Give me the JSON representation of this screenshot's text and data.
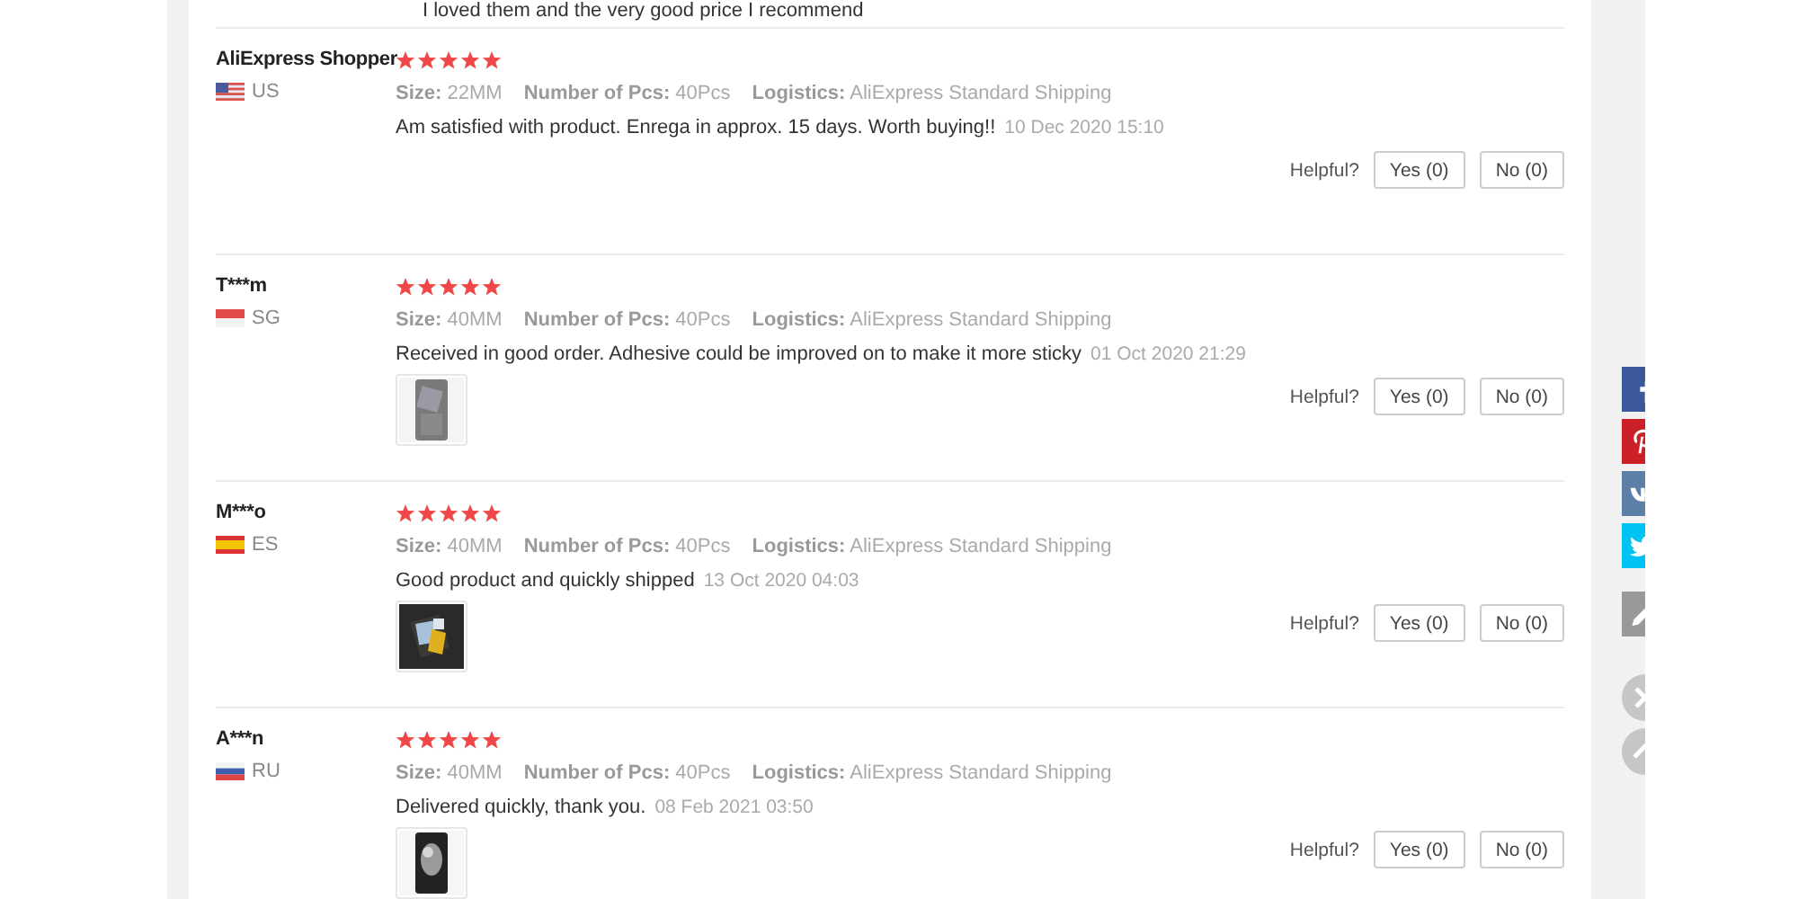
{
  "previous_review_tail": "I loved them and the very good price I recommend",
  "reviews": [
    {
      "name": "AliExpress Shopper",
      "country": "US",
      "stars": 5,
      "attributes": [
        {
          "label": "Size:",
          "value": "22MM"
        },
        {
          "label": "Number of Pcs:",
          "value": "40Pcs"
        },
        {
          "label": "Logistics:",
          "value": "AliExpress Standard Shipping"
        }
      ],
      "text": "Am satisfied with product. Enrega in approx. 15 days. Worth buying!!",
      "date": "10 Dec 2020 15:10",
      "helpful": "Helpful?",
      "yes": "Yes (0)",
      "no": "No (0)"
    },
    {
      "name": "T***m",
      "country": "SG",
      "stars": 5,
      "attributes": [
        {
          "label": "Size:",
          "value": "40MM"
        },
        {
          "label": "Number of Pcs:",
          "value": "40Pcs"
        },
        {
          "label": "Logistics:",
          "value": "AliExpress Standard Shipping"
        }
      ],
      "text": "Received in good order. Adhesive could be improved on to make it more sticky",
      "date": "01 Oct 2020 21:29",
      "photos": [
        {
          "kind": "picture"
        }
      ],
      "helpful": "Helpful?",
      "yes": "Yes (0)",
      "no": "No (0)"
    },
    {
      "name": "M***o",
      "country": "ES",
      "stars": 5,
      "attributes": [
        {
          "label": "Size:",
          "value": "40MM"
        },
        {
          "label": "Number of Pcs:",
          "value": "40Pcs"
        },
        {
          "label": "Logistics:",
          "value": "AliExpress Standard Shipping"
        }
      ],
      "text": "Good product and quickly shipped",
      "date": "13 Oct 2020 04:03",
      "photos": [
        {
          "kind": "picture"
        }
      ],
      "helpful": "Helpful?",
      "yes": "Yes (0)",
      "no": "No (0)"
    },
    {
      "name": "A***n",
      "country": "RU",
      "stars": 5,
      "attributes": [
        {
          "label": "Size:",
          "value": "40MM"
        },
        {
          "label": "Number of Pcs:",
          "value": "40Pcs"
        },
        {
          "label": "Logistics:",
          "value": "AliExpress Standard Shipping"
        }
      ],
      "text": "Delivered quickly, thank you.",
      "date": "08 Feb 2021 03:50",
      "photos": [
        {
          "kind": "picture"
        }
      ],
      "helpful": "Helpful?",
      "yes": "Yes (0)",
      "no": "No (0)"
    }
  ],
  "share_buttons": [
    {
      "kind": "facebook"
    },
    {
      "kind": "pinterest"
    },
    {
      "kind": "vk"
    },
    {
      "kind": "twitter"
    },
    {
      "kind": "edit"
    },
    {
      "kind": "close"
    },
    {
      "kind": "up"
    }
  ]
}
